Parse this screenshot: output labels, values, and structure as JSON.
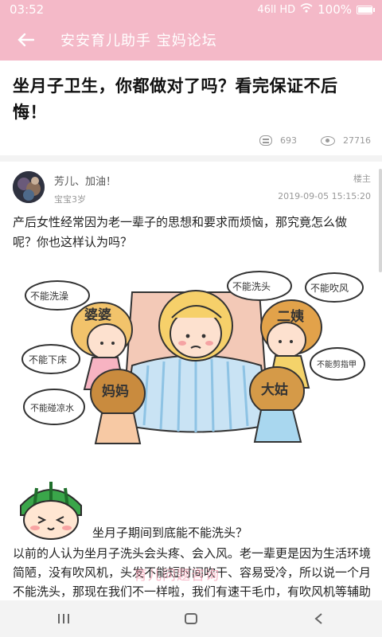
{
  "status_bar": {
    "time": "03:52",
    "network": "46ll HD",
    "battery": "100%",
    "battery_level": 1.0
  },
  "header": {
    "title": "安安育儿助手 宝妈论坛",
    "back_icon": "back-arrow-icon"
  },
  "post": {
    "title": "坐月子卫生，你都做对了吗？看完保证不后悔！",
    "comments": "693",
    "views": "27716"
  },
  "reply": {
    "author": "芳儿、加油！",
    "baby_age": "宝宝3岁",
    "badge": "楼主",
    "timestamp": "2019-09-05 15:15:20",
    "paragraph1": "产后女性经常因为老一辈子的思想和要求而烦恼，那究竟怎么做呢？你也这样认为吗？",
    "illustration": {
      "bubbles": [
        "不能洗澡",
        "不能洗头",
        "不能吹风",
        "不能下床",
        "不能剪指甲",
        "不能碰凉水"
      ],
      "characters": [
        "婆婆",
        "二姨",
        "妈妈",
        "大姑"
      ]
    },
    "sticker_caption": "坐月子期间到底能不能洗头？",
    "paragraph2": "以前的人认为坐月子洗头会头疼、会入风。老一辈更是因为生活环境简陋，没有吹风机，头发不能短时间吹干、容易受冷，所以说一个月不能洗头，那现在我们不一样啦，我们有速干毛巾，有吹风机等辅助工"
  },
  "watermark": "育儿问题咨询",
  "colors": {
    "accent": "#f4b9c8",
    "meta_gray": "#9a9a9a",
    "watermark": "#f4a0b4"
  },
  "nav_bar": {
    "recent_icon": "recent-apps-icon",
    "home_icon": "home-icon",
    "back_icon": "back-chevron-icon"
  }
}
